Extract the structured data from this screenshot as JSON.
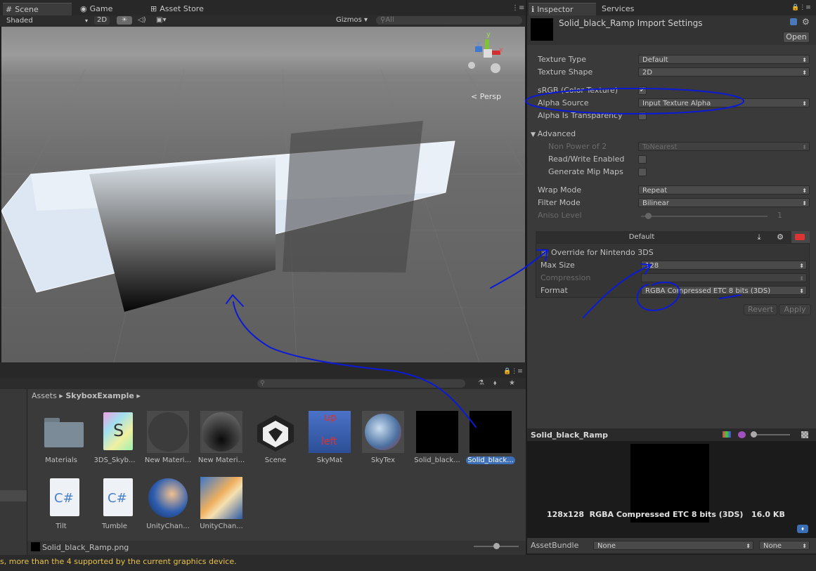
{
  "scene_tabs": {
    "scene": "Scene",
    "game": "Game",
    "asset_store": "Asset Store"
  },
  "scene_toolbar": {
    "shading": "Shaded",
    "mode_2d": "2D",
    "gizmos": "Gizmos",
    "search_placeholder": "All"
  },
  "scene_view": {
    "persp_label": "Persp",
    "axis_y": "y",
    "axis_x": "x",
    "axis_z": "z"
  },
  "inspector_tabs": {
    "inspector": "Inspector",
    "services": "Services"
  },
  "inspector": {
    "title": "Solid_black_Ramp Import Settings",
    "open_button": "Open",
    "texture_type": {
      "label": "Texture Type",
      "value": "Default"
    },
    "texture_shape": {
      "label": "Texture Shape",
      "value": "2D"
    },
    "srgb": {
      "label": "sRGB (Color Texture)",
      "checked": true
    },
    "alpha_source": {
      "label": "Alpha Source",
      "value": "Input Texture Alpha"
    },
    "alpha_transparency": {
      "label": "Alpha Is Transparency",
      "checked": false
    },
    "advanced": {
      "label": "Advanced"
    },
    "non_power_of_2": {
      "label": "Non Power of 2",
      "value": "ToNearest"
    },
    "read_write": {
      "label": "Read/Write Enabled"
    },
    "mip_maps": {
      "label": "Generate Mip Maps"
    },
    "wrap_mode": {
      "label": "Wrap Mode",
      "value": "Repeat"
    },
    "filter_mode": {
      "label": "Filter Mode",
      "value": "Bilinear"
    },
    "aniso_level": {
      "label": "Aniso Level",
      "value": "1"
    },
    "platform_default": "Default",
    "override": {
      "label": "Override for Nintendo 3DS",
      "checked": true
    },
    "max_size": {
      "label": "Max Size",
      "value": "128"
    },
    "compression": {
      "label": "Compression",
      "value": ""
    },
    "format": {
      "label": "Format",
      "value": "RGBA Compressed ETC 8 bits (3DS)"
    },
    "revert_button": "Revert",
    "apply_button": "Apply"
  },
  "preview": {
    "title": "Solid_black_Ramp",
    "info": "128x128  RGBA Compressed ETC 8 bits (3DS)   16.0 KB"
  },
  "asset_bundle": {
    "label": "AssetBundle",
    "value1": "None",
    "value2": "None"
  },
  "project": {
    "breadcrumb_root": "Assets",
    "breadcrumb_folder": "SkyboxExample",
    "assets": [
      {
        "name": "Materials"
      },
      {
        "name": "3DS_Skyb..."
      },
      {
        "name": "New Materi..."
      },
      {
        "name": "New Materi..."
      },
      {
        "name": "Scene"
      },
      {
        "name": "SkyMat"
      },
      {
        "name": "SkyTex"
      },
      {
        "name": "Solid_black..."
      },
      {
        "name": "Solid_black..."
      },
      {
        "name": "Tilt"
      },
      {
        "name": "Tumble"
      },
      {
        "name": "UnityChan..."
      },
      {
        "name": "UnityChan..."
      }
    ],
    "skymat_text_up": "up",
    "skymat_text_left": "left",
    "script_glyph": "C#",
    "shader_glyph": "S",
    "selected_file": "Solid_black_Ramp.png"
  },
  "status_bar": {
    "message": "s, more than the 4 supported by the current graphics device."
  },
  "colors": {
    "accent_selection": "#3d6fb6",
    "annotation_ink": "#0a1ad6",
    "warning_text": "#e8c24a"
  }
}
